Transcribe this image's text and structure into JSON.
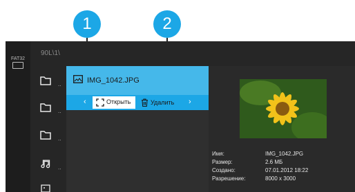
{
  "callouts": [
    "1",
    "2"
  ],
  "drive": {
    "label": "FAT32",
    "icon": "usb-drive-icon"
  },
  "path": "90L\\1\\",
  "list_items": [
    {
      "icon": "folder-icon",
      "label": ".."
    },
    {
      "icon": "folder-icon",
      "label": ".."
    },
    {
      "icon": "folder-icon",
      "label": ".."
    },
    {
      "icon": "music-note-icon",
      "label": ".."
    },
    {
      "icon": "image-icon",
      "label": ""
    }
  ],
  "file": {
    "name": "IMG_1042.JPG",
    "icon": "image-icon"
  },
  "actions": {
    "open_label": "Открыть",
    "delete_label": "Удалить"
  },
  "info": {
    "name_key": "Имя:",
    "name_val": "IMG_1042.JPG",
    "size_key": "Размер:",
    "size_val": "2.6 МБ",
    "created_key": "Создано:",
    "created_val": "07.01.2012 18:22",
    "res_key": "Разрешение:",
    "res_val": "8000 x 3000"
  },
  "colors": {
    "accent": "#1ca7e6",
    "selected_row": "#45b8ea",
    "background": "#2a2a2a"
  }
}
